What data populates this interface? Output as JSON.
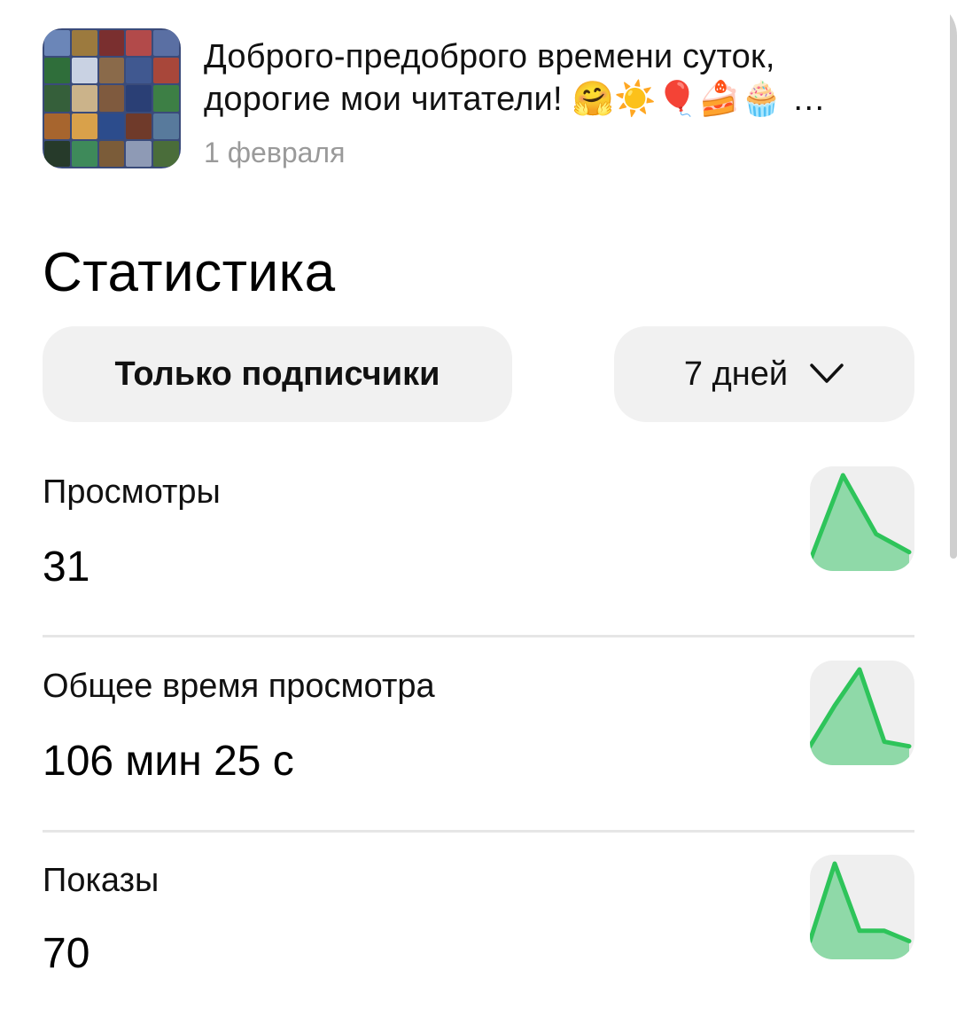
{
  "post": {
    "title": "Доброго-предоброго времени суток, дорогие мои читатели! 🤗☀️🎈🍰🧁 …",
    "date": "1 февраля"
  },
  "stats": {
    "title": "Статистика",
    "filter_label": "Только подписчики",
    "period_label": "7 дней"
  },
  "metrics": [
    {
      "label": "Просмотры",
      "value": "31",
      "trend": [
        5,
        100,
        35,
        15
      ]
    },
    {
      "label": "Общее время просмотра",
      "value": "106 мин 25 с",
      "trend": [
        15,
        60,
        100,
        20,
        15
      ]
    },
    {
      "label": "Показы",
      "value": "70",
      "trend": [
        10,
        70,
        18,
        18,
        10
      ]
    }
  ],
  "colors": {
    "spark_line": "#2ec45a",
    "spark_fill": "#8fd9a8",
    "spark_bg": "#efefef",
    "pill_bg": "#f1f1f1",
    "muted_text": "#9a9a9a"
  }
}
